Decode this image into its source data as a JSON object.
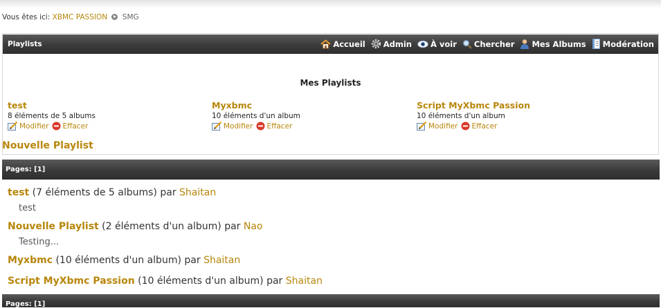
{
  "breadcrumb": {
    "prefix": "Vous êtes ici:",
    "root": "XBMC PASSION",
    "current": "SMG"
  },
  "titlebar": {
    "title": "Playlists",
    "menu": [
      "Accueil",
      "Admin",
      "À voir",
      "Chercher",
      "Mes Albums",
      "Modération"
    ]
  },
  "section_title": "Mes Playlists",
  "cards": [
    {
      "name": "test",
      "count": "8 éléments de 5 albums",
      "edit": "Modifier",
      "delete": "Effacer"
    },
    {
      "name": "Myxbmc",
      "count": "10 éléments d'un album",
      "edit": "Modifier",
      "delete": "Effacer"
    },
    {
      "name": "Script MyXbmc Passion",
      "count": "10 éléments d'un album",
      "edit": "Modifier",
      "delete": "Effacer"
    }
  ],
  "new_playlist": "Nouvelle Playlist",
  "pages_label": "Pages: [1]",
  "by": "par",
  "playlists": [
    {
      "name": "test",
      "info": "(7 éléments de 5 albums)",
      "user": "Shaitan",
      "desc": "test"
    },
    {
      "name": "Nouvelle Playlist",
      "info": "(2 éléments d'un album)",
      "user": "Nao",
      "desc": "Testing..."
    },
    {
      "name": "Myxbmc",
      "info": "(10 éléments d'un album)",
      "user": "Shaitan",
      "desc": ""
    },
    {
      "name": "Script MyXbmc Passion",
      "info": "(10 éléments d'un album)",
      "user": "Shaitan",
      "desc": ""
    }
  ]
}
